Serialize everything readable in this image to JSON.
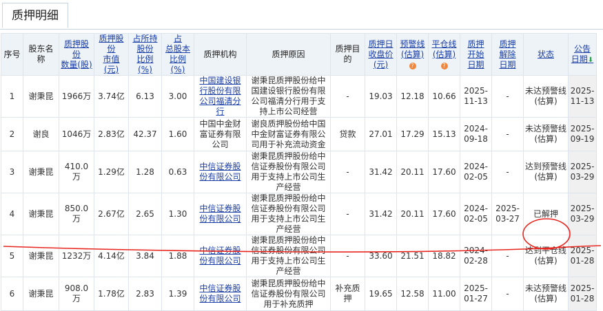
{
  "tab": {
    "title": "质押明细"
  },
  "columns": [
    {
      "lines": [
        "序号"
      ],
      "sortable": false
    },
    {
      "lines": [
        "股东名称"
      ],
      "sortable": false
    },
    {
      "lines": [
        "质押股份",
        "数量(股)"
      ],
      "sortable": true
    },
    {
      "lines": [
        "质押股份",
        "市值(元)"
      ],
      "sortable": true
    },
    {
      "lines": [
        "占所持",
        "股份",
        "比例(%)"
      ],
      "sortable": true
    },
    {
      "lines": [
        "占",
        "总股本",
        "比例(%)"
      ],
      "sortable": true
    },
    {
      "lines": [
        "质押机构"
      ],
      "sortable": false
    },
    {
      "lines": [
        "质押原因"
      ],
      "sortable": false
    },
    {
      "lines": [
        "质押目的"
      ],
      "sortable": false
    },
    {
      "lines": [
        "质押日",
        "收盘价",
        "(元)"
      ],
      "sortable": true
    },
    {
      "lines": [
        "预警线",
        "(估算)"
      ],
      "sortable": true,
      "help": true
    },
    {
      "lines": [
        "平仓线",
        "(估算)"
      ],
      "sortable": true,
      "help": true
    },
    {
      "lines": [
        "质押",
        "开始",
        "日期"
      ],
      "sortable": true
    },
    {
      "lines": [
        "质押",
        "解除",
        "日期"
      ],
      "sortable": true
    },
    {
      "lines": [
        "状态"
      ],
      "sortable": true
    },
    {
      "lines": [
        "公告",
        "日期"
      ],
      "sortable": true,
      "sorted": true
    }
  ],
  "help_icon": "question-icon",
  "sort_arrow_icon": "sort-down-arrow-icon",
  "rows": [
    {
      "no": "1",
      "holder": "谢秉昆",
      "qty": "1966万",
      "mv": "3.74亿",
      "pct_held": "6.13",
      "pct_total": "3.00",
      "org": "中国建设银行股份有限公司福清分行",
      "org_link": true,
      "reason": "谢秉昆质押股份给中国建设银行股份有限公司福清分行用于支持上市公司经营",
      "purpose": "-",
      "close": "19.03",
      "warn": "12.18",
      "liq": "10.66",
      "start": "2025-11-13",
      "release": "-",
      "status": "未达预警线(估算)",
      "ann": "2025-11-13"
    },
    {
      "no": "2",
      "holder": "谢良",
      "qty": "1046万",
      "mv": "2.83亿",
      "pct_held": "42.37",
      "pct_total": "1.60",
      "org": "中国中金财富证券有限公司",
      "org_link": false,
      "reason": "谢良质押股份给中国中金财富证券有限公司用于补充流动资金",
      "purpose": "贷款",
      "close": "27.01",
      "warn": "17.29",
      "liq": "15.13",
      "start": "2024-09-18",
      "release": "-",
      "status": "未达预警线(估算)",
      "ann": "2025-09-19"
    },
    {
      "no": "3",
      "holder": "谢秉昆",
      "qty": "410.0万",
      "mv": "1.29亿",
      "pct_held": "1.28",
      "pct_total": "0.63",
      "org": "中信证券股份有限公司",
      "org_link": true,
      "reason": "谢秉昆质押股份给中信证券股份有限公司用于支持上市公司生产经营",
      "purpose": "-",
      "close": "31.42",
      "warn": "20.11",
      "liq": "17.60",
      "start": "2024-02-05",
      "release": "-",
      "status": "达到预警线(估算)",
      "ann": "2025-03-29"
    },
    {
      "no": "4",
      "holder": "谢秉昆",
      "qty": "850.0万",
      "mv": "2.67亿",
      "pct_held": "2.65",
      "pct_total": "1.30",
      "org": "中信证券股份有限公司",
      "org_link": true,
      "reason": "谢秉昆质押股份给中信证券股份有限公司用于支持上市公司生产经营",
      "purpose": "-",
      "close": "31.42",
      "warn": "20.11",
      "liq": "17.60",
      "start": "2024-02-05",
      "release": "2025-03-27",
      "status": "已解押",
      "ann": "2025-03-29"
    },
    {
      "no": "5",
      "holder": "谢秉昆",
      "qty": "1232万",
      "mv": "4.14亿",
      "pct_held": "3.84",
      "pct_total": "1.88",
      "org": "中信证券股份有限公司",
      "org_link": true,
      "reason": "谢秉昆质押股份给中信证券股份有限公司用于支持上市公司生产经营",
      "purpose": "-",
      "close": "33.60",
      "warn": "21.51",
      "liq": "18.82",
      "start": "2024-02-28",
      "release": "-",
      "status": "达到平仓线(估算)",
      "ann": "2025-01-28"
    },
    {
      "no": "6",
      "holder": "谢秉昆",
      "qty": "908.0万",
      "mv": "1.78亿",
      "pct_held": "2.83",
      "pct_total": "1.39",
      "org": "中信证券股份有限公司",
      "org_link": true,
      "reason": "谢秉昆质押股份给中信证券股份有限公司用于补充质押",
      "purpose": "补充质押",
      "close": "19.65",
      "warn": "12.58",
      "liq": "11.00",
      "start": "2025-01-27",
      "release": "-",
      "status": "未达预警线(估算)",
      "ann": "2025-01-28"
    }
  ],
  "annotation_color": "#e8241c",
  "link_color": "#1a3ea8"
}
